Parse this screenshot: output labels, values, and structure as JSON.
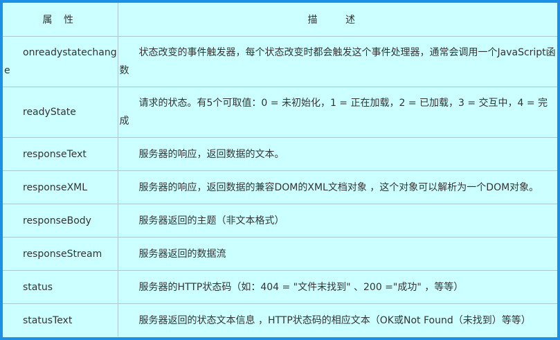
{
  "header": {
    "property_label": "属 性",
    "description_label": "描 述"
  },
  "rows": [
    {
      "name": "onreadystatechange",
      "description": "状态改变的事件触发器，每个状态改变时都会触发这个事件处理器，通常会调用一个JavaScript函数"
    },
    {
      "name": "readyState",
      "description": "请求的状态。有5个可取值：0 = 未初始化，1 = 正在加载，2 = 已加载，3 = 交互中，4 = 完成"
    },
    {
      "name": "responseText",
      "description": "服务器的响应，返回数据的文本。"
    },
    {
      "name": "responseXML",
      "description": "服务器的响应，返回数据的兼容DOM的XML文档对象 ，这个对象可以解析为一个DOM对象。"
    },
    {
      "name": "responseBody",
      "description": "服务器返回的主题（非文本格式）"
    },
    {
      "name": "responseStream",
      "description": "服务器返回的数据流"
    },
    {
      "name": "status",
      "description": "服务器的HTTP状态码（如：404 = \"文件末找到\" 、200 =\"成功\" ，等等）"
    },
    {
      "name": "statusText",
      "description": "服务器返回的状态文本信息 ，HTTP状态码的相应文本（OK或Not Found（未找到）等等）"
    }
  ],
  "colors": {
    "frame_border": "#1e8fe6",
    "table_background": "#ccffff",
    "grid_line": "#a9c8d8",
    "text": "#333333"
  }
}
